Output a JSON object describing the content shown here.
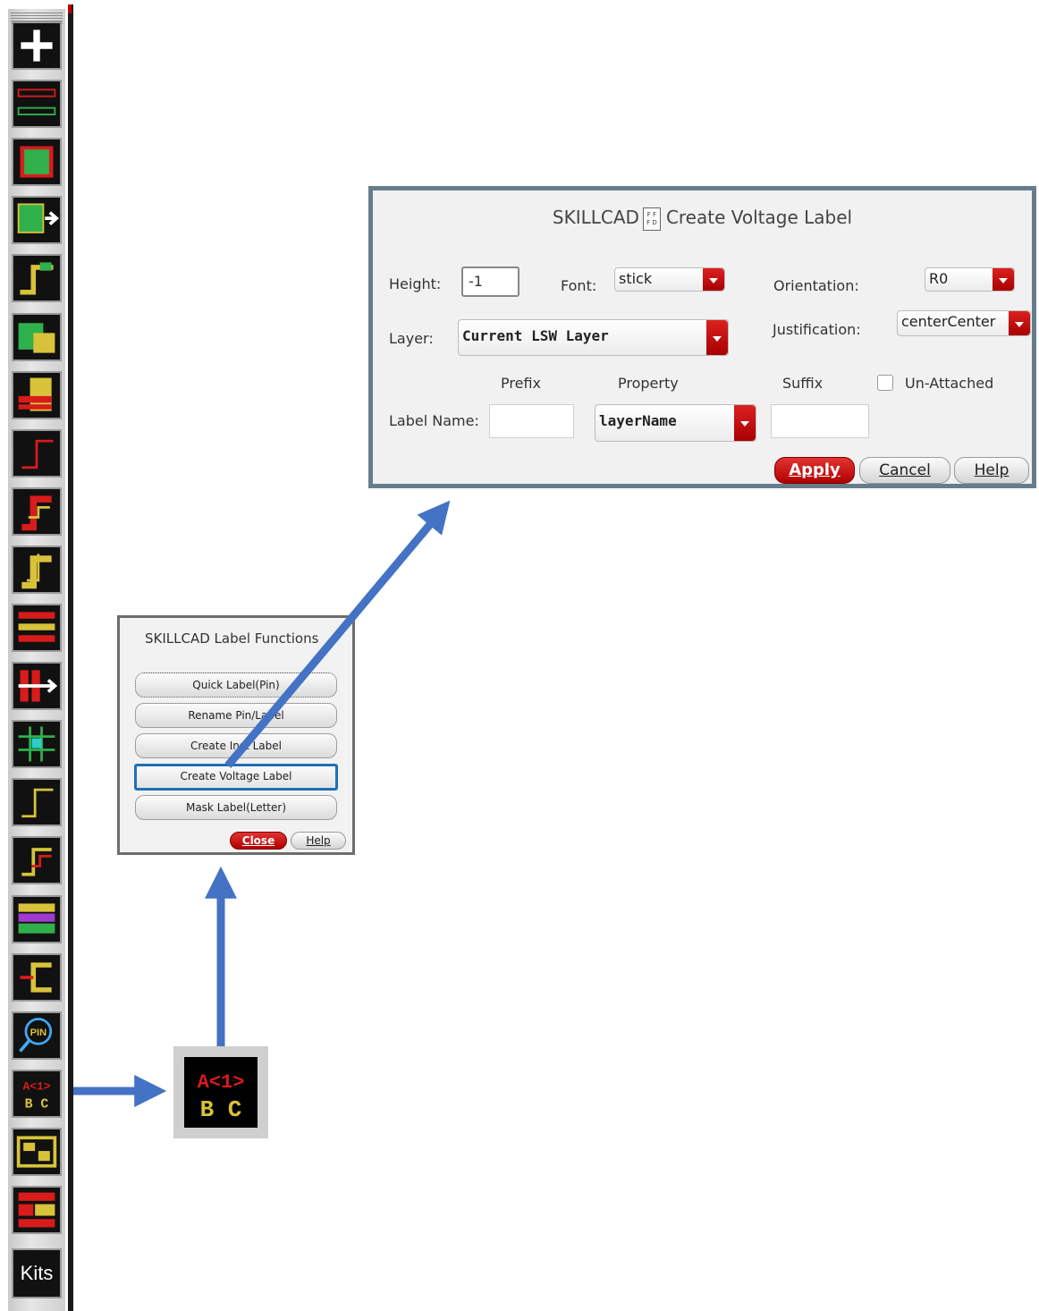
{
  "colors": {
    "accent_blue": "#4472c4",
    "selection_blue": "#1f6fb6",
    "dialog_frame": "#667d8c",
    "red_button": "#c00000",
    "icon_yellow": "#d8c23a",
    "icon_red": "#d81b1b",
    "icon_green": "#2fb04a"
  },
  "toolbar": {
    "icons": [
      "cross-plus-icon",
      "stripe-bars-icon",
      "green-block-icon",
      "move-grid-icon",
      "step-wire-icon",
      "hatch-shapes-icon",
      "stacked-layers-icon",
      "red-step-icon",
      "red-step-double-icon",
      "yellow-step-icon",
      "stacked-grid-icon",
      "move-arrow-icon",
      "cross-grid-icon",
      "thin-step-icon",
      "orange-step-icon",
      "pattern-block-icon",
      "bracket-shape-icon",
      "pin-search-icon",
      "label-abc-icon",
      "frame-block-icon",
      "red-pattern-icon"
    ],
    "kits_label": "Kits"
  },
  "zoom_icon": {
    "top_text": "A<1>",
    "bottom_text": "B C"
  },
  "label_functions": {
    "title": "SKILLCAD Label Functions",
    "buttons": [
      "Quick Label(Pin)",
      "Rename Pin/Label",
      "Create Inst Label",
      "Create Voltage Label",
      "Mask Label(Letter)"
    ],
    "close_label": "Close",
    "help_label": "Help"
  },
  "voltage_label": {
    "title_prefix": "SKILLCAD",
    "title_logo_top": "F F",
    "title_logo_bottom": "F D",
    "title_suffix": "Create Voltage Label",
    "height_label": "Height:",
    "height_value": "-1",
    "font_label": "Font:",
    "font_value": "stick",
    "orientation_label": "Orientation:",
    "orientation_value": "R0",
    "layer_label": "Layer:",
    "layer_value": "Current LSW Layer",
    "justification_label": "Justification:",
    "justification_value": "centerCenter",
    "prefix_header": "Prefix",
    "property_header": "Property",
    "suffix_header": "Suffix",
    "unattached_label": "Un-Attached",
    "label_name_label": "Label Name:",
    "prefix_value": "",
    "property_value": "layerName",
    "suffix_value": "",
    "apply_label": "Apply",
    "cancel_label": "Cancel",
    "help_label": "Help"
  }
}
